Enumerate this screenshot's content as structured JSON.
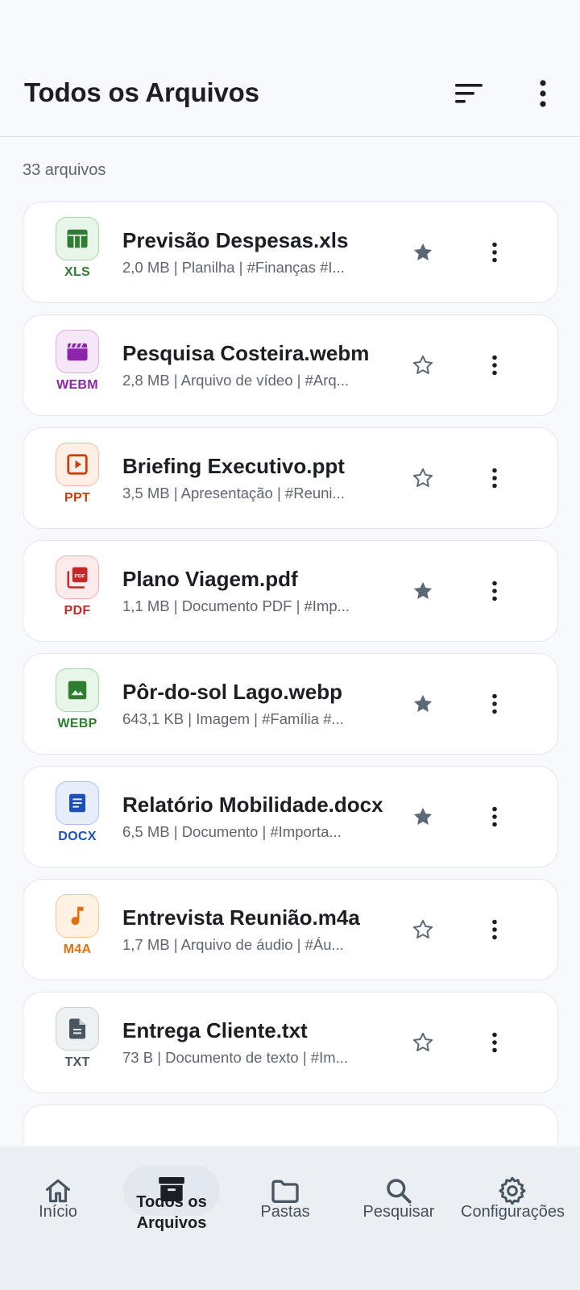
{
  "header": {
    "title": "Todos os Arquivos",
    "sort_icon": "sort-icon",
    "more_icon": "more-vertical-icon"
  },
  "file_count": "33 arquivos",
  "files": [
    {
      "name": "Previsão Despesas.xls",
      "meta": "2,0 MB | Planilha | #Finanças  #I...",
      "ext": "XLS",
      "icon": "table-icon",
      "starred": true,
      "color": "#2e7d32",
      "bg": "#e8f5e9",
      "border": "#a5d6a7"
    },
    {
      "name": "Pesquisa Costeira.webm",
      "meta": "2,8 MB | Arquivo de vídeo | #Arq...",
      "ext": "WEBM",
      "icon": "movie-icon",
      "starred": false,
      "color": "#8e24aa",
      "bg": "#f5e6f8",
      "border": "#dcb0e6"
    },
    {
      "name": "Briefing Executivo.ppt",
      "meta": "3,5 MB | Apresentação | #Reuni...",
      "ext": "PPT",
      "icon": "slideshow-icon",
      "starred": false,
      "color": "#c2410c",
      "bg": "#fdeee6",
      "border": "#f3bfa4"
    },
    {
      "name": "Plano Viagem.pdf",
      "meta": "1,1 MB | Documento PDF | #Imp...",
      "ext": "PDF",
      "icon": "pdf-icon",
      "starred": true,
      "color": "#c62828",
      "bg": "#fdeaea",
      "border": "#f1b1b1"
    },
    {
      "name": "Pôr-do-sol Lago.webp",
      "meta": "643,1 KB | Imagem | #Família  #...",
      "ext": "WEBP",
      "icon": "image-icon",
      "starred": true,
      "color": "#2e7d32",
      "bg": "#e8f5e9",
      "border": "#a5d6a7"
    },
    {
      "name": "Relatório Mobilidade.docx",
      "meta": "6,5 MB | Documento | #Importa...",
      "ext": "DOCX",
      "icon": "document-icon",
      "starred": true,
      "color": "#1e4fb4",
      "bg": "#e6eefc",
      "border": "#a9c1ee"
    },
    {
      "name": "Entrevista Reunião.m4a",
      "meta": "1,7 MB | Arquivo de áudio | #Áu...",
      "ext": "M4A",
      "icon": "music-note-icon",
      "starred": false,
      "color": "#e07010",
      "bg": "#fff1e3",
      "border": "#f7c891"
    },
    {
      "name": "Entrega Cliente.txt",
      "meta": "73 B | Documento de texto | #Im...",
      "ext": "TXT",
      "icon": "text-file-icon",
      "starred": false,
      "color": "#4a5560",
      "bg": "#eef1f4",
      "border": "#c8cfd6"
    }
  ],
  "nav": [
    {
      "label": "Início",
      "icon": "home-icon",
      "active": false
    },
    {
      "label": "Todos os Arquivos",
      "icon": "archive-box-icon",
      "active": true
    },
    {
      "label": "Pastas",
      "icon": "folder-icon",
      "active": false
    },
    {
      "label": "Pesquisar",
      "icon": "search-icon",
      "active": false
    },
    {
      "label": "Configurações",
      "icon": "gear-icon",
      "active": false
    }
  ],
  "colors": {
    "background": "#f7f9fc",
    "card": "#ffffff",
    "star_filled": "#5c6876",
    "star_outline": "#5c6876",
    "nav_bg": "#ebeff4"
  }
}
